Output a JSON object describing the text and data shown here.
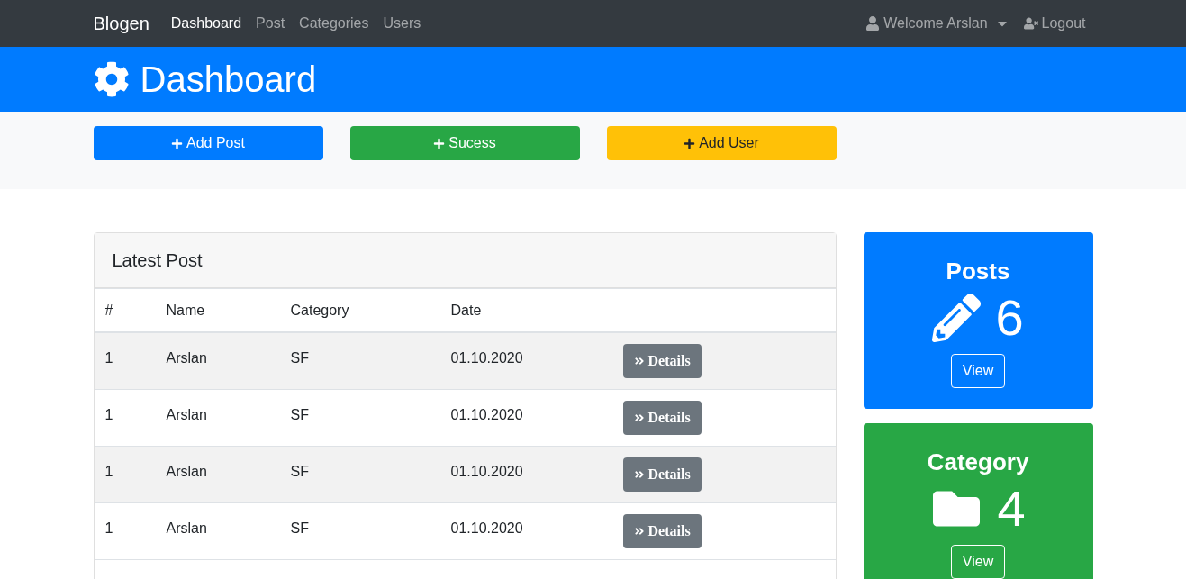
{
  "navbar": {
    "brand": "Blogen",
    "links": [
      {
        "label": "Dashboard",
        "selected": true
      },
      {
        "label": "Post",
        "selected": false
      },
      {
        "label": "Categories",
        "selected": false
      },
      {
        "label": "Users",
        "selected": false
      }
    ],
    "user_menu": "Welcome Arslan",
    "logout": "Logout"
  },
  "header": {
    "title": "Dashboard"
  },
  "actions": [
    {
      "label": "Add Post",
      "kind": "primary"
    },
    {
      "label": "Sucess",
      "kind": "success"
    },
    {
      "label": "Add User",
      "kind": "warning"
    }
  ],
  "latest_post": {
    "title": "Latest Post",
    "columns": [
      "#",
      "Name",
      "Category",
      "Date"
    ],
    "rows": [
      {
        "cells": [
          "1",
          "Arslan",
          "SF",
          "01.10.2020"
        ],
        "action": "Details"
      },
      {
        "cells": [
          "1",
          "Arslan",
          "SF",
          "01.10.2020"
        ],
        "action": "Details"
      },
      {
        "cells": [
          "1",
          "Arslan",
          "SF",
          "01.10.2020"
        ],
        "action": "Details"
      },
      {
        "cells": [
          "1",
          "Arslan",
          "SF",
          "01.10.2020"
        ],
        "action": "Details"
      }
    ]
  },
  "stats": [
    {
      "title": "Posts",
      "count": "6",
      "button": "View",
      "kind": "posts"
    },
    {
      "title": "Category",
      "count": "4",
      "button": "View",
      "kind": "category"
    }
  ]
}
